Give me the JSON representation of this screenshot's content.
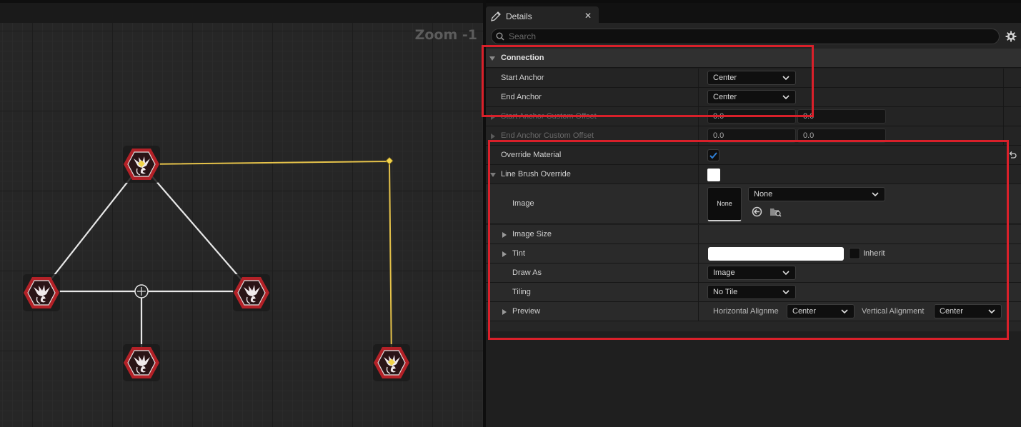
{
  "graph": {
    "zoom_label": "Zoom -1"
  },
  "details": {
    "tab_title": "Details",
    "tab_close": "✕",
    "search": {
      "placeholder": "Search",
      "value": ""
    },
    "sections": {
      "connection": {
        "header": "Connection",
        "start_anchor": {
          "label": "Start Anchor",
          "value": "Center"
        },
        "end_anchor": {
          "label": "End Anchor",
          "value": "Center"
        },
        "start_custom_offset": {
          "label": "Start Anchor Custom Offset",
          "x": "0.0",
          "y": "0.0"
        },
        "end_custom_offset": {
          "label": "End Anchor Custom Offset",
          "x": "0.0",
          "y": "0.0"
        }
      },
      "override": {
        "override_material": {
          "label": "Override Material",
          "checked": true
        },
        "line_brush_override": {
          "label": "Line Brush Override"
        },
        "image": {
          "label": "Image",
          "thumbnail": "None",
          "value": "None"
        },
        "image_size": {
          "label": "Image Size"
        },
        "tint": {
          "label": "Tint",
          "inherit_label": "Inherit"
        },
        "draw_as": {
          "label": "Draw As",
          "value": "Image"
        },
        "tiling": {
          "label": "Tiling",
          "value": "No Tile"
        },
        "preview": {
          "label": "Preview",
          "horizontal_label": "Horizontal Alignme",
          "horizontal_value": "Center",
          "vertical_label": "Vertical Alignment",
          "vertical_value": "Center"
        }
      }
    }
  },
  "colors": {
    "accent_red": "#d9202a",
    "connection_yellow": "#e6c34a",
    "node_red": "#b32127",
    "check_blue": "#2f7fd6"
  },
  "icons": {
    "tab": "pencil-icon",
    "search": "magnifier-icon",
    "settings": "gear-icon",
    "reset": "reset-arrow-icon",
    "use_selected": "use-selected-arrow-icon",
    "browse": "browse-folder-icon",
    "node": "eagle-emblem-icon"
  }
}
